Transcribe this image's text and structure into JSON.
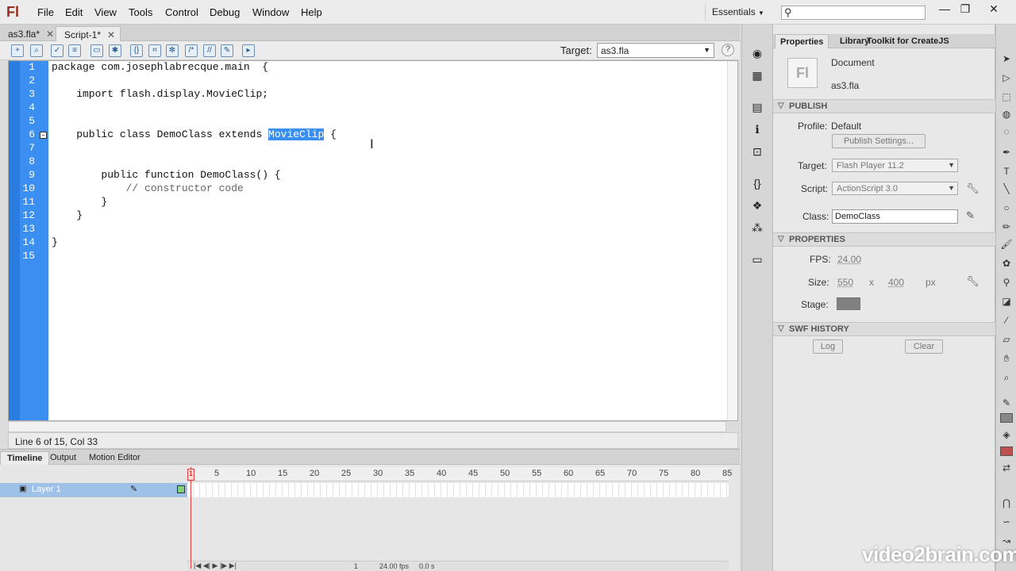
{
  "app": {
    "logo": "Fl"
  },
  "menu": [
    "File",
    "Edit",
    "View",
    "Tools",
    "Control",
    "Debug",
    "Window",
    "Help"
  ],
  "workspace": "Essentials",
  "window_buttons": [
    "—",
    "❐",
    "✕"
  ],
  "tabs": [
    {
      "label": "as3.fla*",
      "close": "✕"
    },
    {
      "label": "Script-1*",
      "close": "✕"
    }
  ],
  "toolbar": {
    "target_label": "Target:",
    "target_value": "as3.fla",
    "help": "?"
  },
  "code": {
    "line_numbers": [
      "1",
      "2",
      "3",
      "4",
      "5",
      "6",
      "7",
      "8",
      "9",
      "10",
      "11",
      "12",
      "13",
      "14",
      "15"
    ],
    "lines": [
      "package com.josephlabrecque.main  {",
      "",
      "    import flash.display.MovieClip;",
      "",
      "",
      "    public class DemoClass extends ",
      "",
      "",
      "        public function DemoClass() {",
      "            // constructor code",
      "        }",
      "    }",
      "",
      "}",
      ""
    ],
    "selected_word": "MovieClip",
    "after_selection": " {"
  },
  "status": "Line 6 of 15, Col 33",
  "timeline": {
    "tabs": [
      "Timeline",
      "Output",
      "Motion Editor"
    ],
    "ruler": [
      "1",
      "5",
      "10",
      "15",
      "20",
      "25",
      "30",
      "35",
      "40",
      "45",
      "50",
      "55",
      "60",
      "65",
      "70",
      "75",
      "80",
      "85"
    ],
    "layer": "Layer 1",
    "current_frame": "1",
    "fps": "24.00 fps",
    "time": "0.0 s"
  },
  "properties": {
    "tabs": [
      "Properties",
      "Library",
      "Toolkit for CreateJS"
    ],
    "doc_type": "Document",
    "doc_name": "as3.fla",
    "doc_icon": "Fl",
    "publish": {
      "header": "PUBLISH",
      "profile_label": "Profile:",
      "profile_value": "Default",
      "settings_button": "Publish Settings...",
      "target_label": "Target:",
      "target_value": "Flash Player 11.2",
      "script_label": "Script:",
      "script_value": "ActionScript 3.0",
      "class_label": "Class:",
      "class_value": "DemoClass"
    },
    "props": {
      "header": "PROPERTIES",
      "fps_label": "FPS:",
      "fps_value": "24.00",
      "size_label": "Size:",
      "width": "550",
      "x": "x",
      "height": "400",
      "unit": "px",
      "stage_label": "Stage:",
      "stage_color": "#808080"
    },
    "swf": {
      "header": "SWF HISTORY",
      "log": "Log",
      "clear": "Clear"
    }
  },
  "watermark": "video2brain.com"
}
